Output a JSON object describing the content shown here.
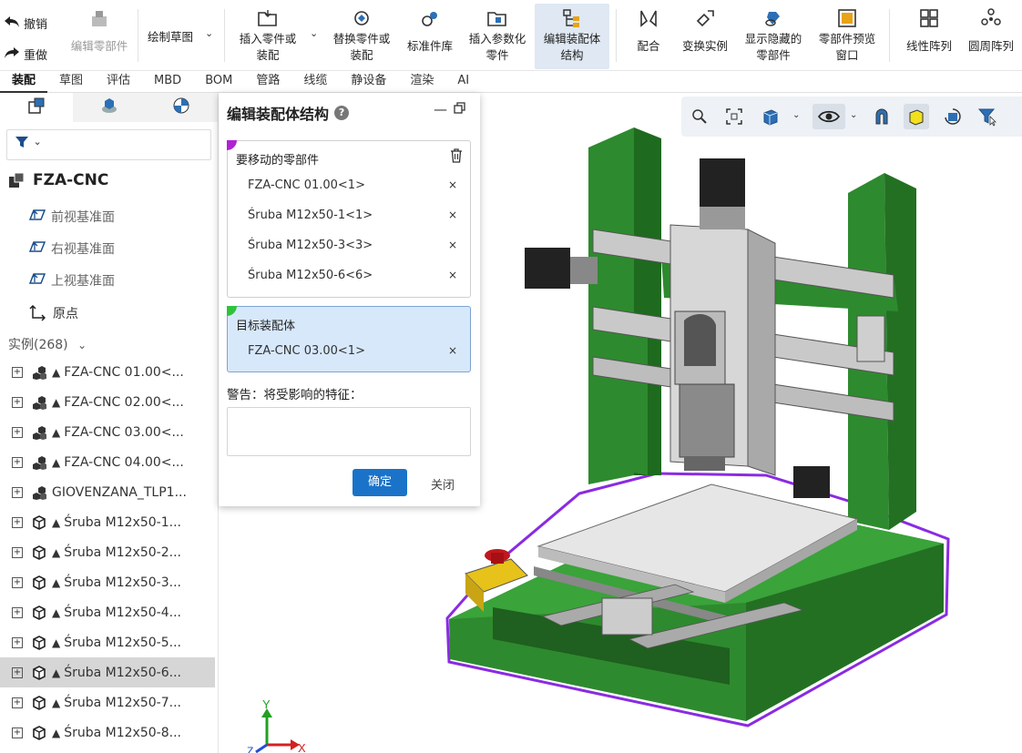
{
  "toolbar": {
    "undo": "撤销",
    "redo": "重做",
    "edit_part": "编辑零部件",
    "sketch": "绘制草图",
    "insert_part": [
      "插入零件或",
      "装配"
    ],
    "replace_part": [
      "替换零件或",
      "装配"
    ],
    "std_lib": "标准件库",
    "insert_param": [
      "插入参数化",
      "零件"
    ],
    "edit_struct": [
      "编辑装配体",
      "结构"
    ],
    "mate": "配合",
    "transform": "变换实例",
    "show_hidden": [
      "显示隐藏的",
      "零部件"
    ],
    "preview": [
      "零部件预览",
      "窗口"
    ],
    "linear_array": "线性阵列",
    "circular_array": "圆周阵列"
  },
  "tabs": [
    "装配",
    "草图",
    "评估",
    "MBD",
    "BOM",
    "管路",
    "线缆",
    "静设备",
    "渲染",
    "AI"
  ],
  "tree": {
    "root": "FZA-CNC",
    "planes": [
      "前视基准面",
      "右视基准面",
      "上视基准面"
    ],
    "origin": "原点",
    "instances_header": "实例(268)",
    "rows": [
      {
        "label": "FZA-CNC 01.00<...",
        "kind": "asm",
        "warn": true
      },
      {
        "label": "FZA-CNC 02.00<...",
        "kind": "asm",
        "warn": true
      },
      {
        "label": "FZA-CNC 03.00<...",
        "kind": "asm",
        "warn": true
      },
      {
        "label": "FZA-CNC 04.00<...",
        "kind": "asm",
        "warn": true
      },
      {
        "label": "GIOVENZANA_TLP1...",
        "kind": "asm",
        "warn": false
      },
      {
        "label": "Śruba M12x50-1...",
        "kind": "part",
        "warn": true
      },
      {
        "label": "Śruba M12x50-2...",
        "kind": "part",
        "warn": true
      },
      {
        "label": "Śruba M12x50-3...",
        "kind": "part",
        "warn": true
      },
      {
        "label": "Śruba M12x50-4...",
        "kind": "part",
        "warn": true
      },
      {
        "label": "Śruba M12x50-5...",
        "kind": "part",
        "warn": true
      },
      {
        "label": "Śruba M12x50-6...",
        "kind": "part",
        "warn": true
      },
      {
        "label": "Śruba M12x50-7...",
        "kind": "part",
        "warn": true
      },
      {
        "label": "Śruba M12x50-8...",
        "kind": "part",
        "warn": true
      }
    ],
    "selected_index": 10
  },
  "dialog": {
    "title": "编辑装配体结构",
    "move_label": "要移动的零部件",
    "move_items": [
      "FZA-CNC 01.00<1>",
      "Śruba M12x50-1<1>",
      "Śruba M12x50-3<3>",
      "Śruba M12x50-6<6>"
    ],
    "target_label": "目标装配体",
    "target_items": [
      "FZA-CNC 03.00<1>"
    ],
    "warning_label": "警告：将受影响的特征：",
    "ok": "确定",
    "close": "关闭",
    "remove_glyph": "×"
  },
  "axes": {
    "y": "Y",
    "x": "X",
    "z": "Z"
  },
  "colors": {
    "frame": "#2e8a2e",
    "highlight": "#8a2be2",
    "accent": "#1a73c8"
  }
}
